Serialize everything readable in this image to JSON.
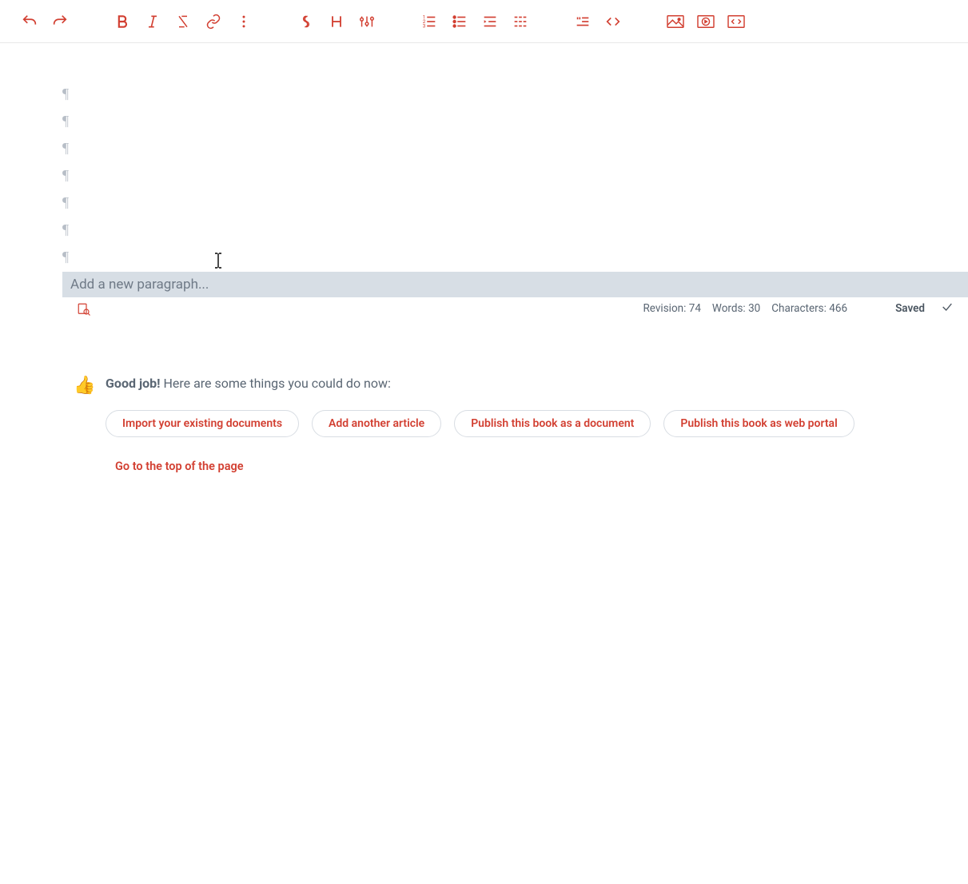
{
  "toolbar": {
    "icons": [
      "undo-icon",
      "redo-icon",
      "bold-icon",
      "italic-icon",
      "strikethrough-icon",
      "link-icon",
      "more-vertical-icon",
      "section-icon",
      "heading-icon",
      "heading-settings-icon",
      "list-ordered-icon",
      "list-unordered-icon",
      "list-indent-icon",
      "list-grid-icon",
      "quote-icon",
      "code-icon",
      "image-icon",
      "video-icon",
      "embed-icon"
    ]
  },
  "editor": {
    "empty_paragraphs": 7,
    "new_paragraph_placeholder": "Add a new paragraph..."
  },
  "status": {
    "revision_label": "Revision:",
    "revision_value": "74",
    "words_label": "Words:",
    "words_value": "30",
    "characters_label": "Characters:",
    "characters_value": "466",
    "saved_label": "Saved"
  },
  "suggestion": {
    "bold": "Good job!",
    "rest": "Here are some things you could do now:",
    "pills": [
      "Import your existing documents",
      "Add another article",
      "Publish this book as a document",
      "Publish this book as web portal"
    ],
    "top_link": "Go to the top of the page"
  }
}
